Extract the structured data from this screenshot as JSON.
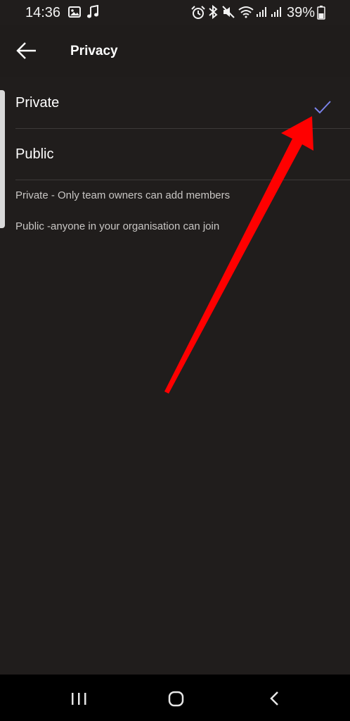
{
  "status_bar": {
    "time": "14:36",
    "battery": "39%",
    "icons": [
      "image-icon",
      "music-note-icon",
      "alarm-icon",
      "bluetooth-icon",
      "mute-icon",
      "wifi-icon",
      "signal-icon",
      "signal-icon",
      "battery-icon"
    ]
  },
  "header": {
    "back_icon": "arrow-left-icon",
    "title": "Privacy"
  },
  "options": [
    {
      "label": "Private",
      "selected": true
    },
    {
      "label": "Public",
      "selected": false
    }
  ],
  "descriptions": [
    "Private - Only team owners can add members",
    "Public -anyone in your organisation can join"
  ],
  "nav_bar": {
    "icons": [
      "recent-apps-icon",
      "home-icon",
      "back-icon"
    ]
  },
  "colors": {
    "background": "#201d1c",
    "accent_check": "#7b83eb",
    "annotation_arrow": "#ff0000",
    "text_primary": "#ffffff",
    "text_secondary": "#c8c6c4"
  }
}
